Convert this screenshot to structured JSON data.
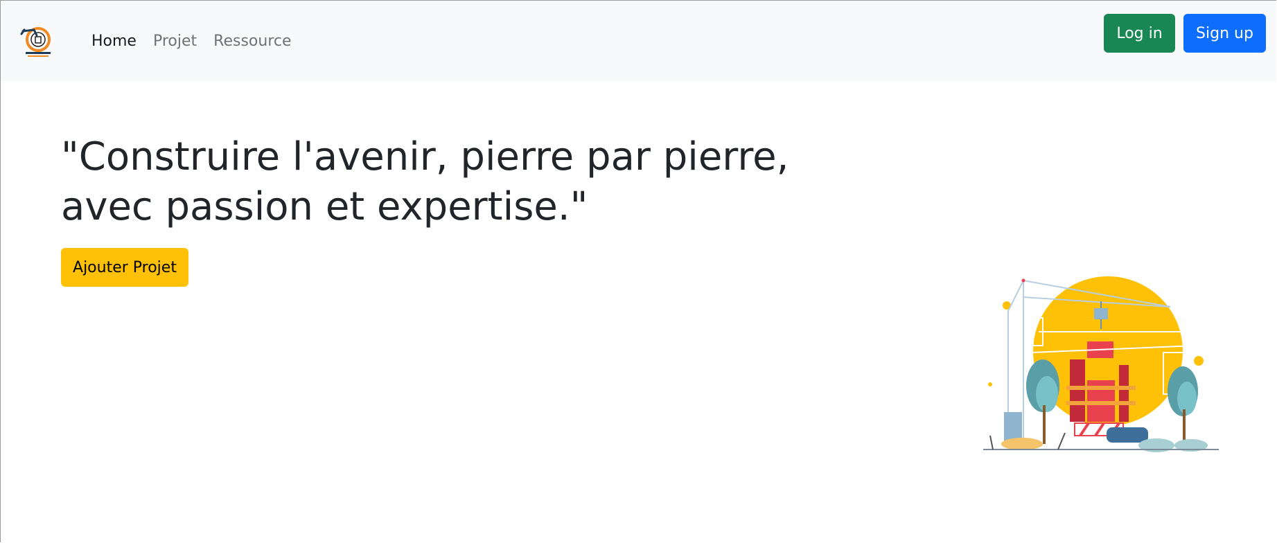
{
  "navbar": {
    "brand_icon": "construction-logo-icon",
    "links": [
      {
        "label": "Home",
        "active": true
      },
      {
        "label": "Projet",
        "active": false
      },
      {
        "label": "Ressource",
        "active": false
      }
    ],
    "login_label": "Log in",
    "signup_label": "Sign up"
  },
  "hero": {
    "title": "\"Construire l'avenir, pierre par pierre, avec passion et expertise.\"",
    "add_button_label": "Ajouter Projet",
    "illustration_icon": "construction-site-illustration"
  },
  "colors": {
    "navbar_bg": "#f8f9fa",
    "login": "#198754",
    "signup": "#0d6efd",
    "add": "#ffc107",
    "illustration_sun": "#ffc107",
    "illustration_red": "#e9414d",
    "illustration_teal": "#5a9ea7"
  }
}
